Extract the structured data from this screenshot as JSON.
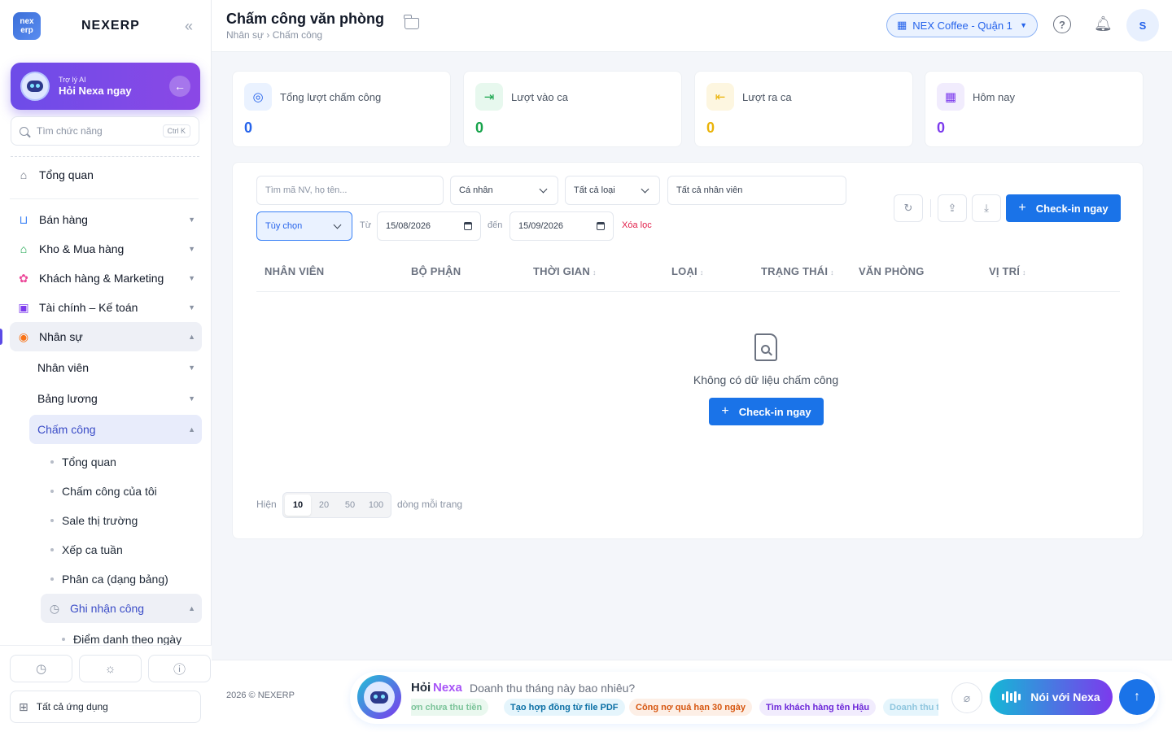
{
  "brand": {
    "logo_text": "nex erp",
    "name": "NEXERP"
  },
  "ai_card": {
    "small": "Trợ lý AI",
    "big": "Hỏi Nexa ngay"
  },
  "search": {
    "placeholder": "Tìm chức năng",
    "shortcut": "Ctrl K"
  },
  "sidebar": {
    "overview": "Tổng quan",
    "groups": [
      {
        "label": "Bán hàng",
        "icon": "cart-icon"
      },
      {
        "label": "Kho & Mua hàng",
        "icon": "bag-icon"
      },
      {
        "label": "Khách hàng & Marketing",
        "icon": "people-icon"
      },
      {
        "label": "Tài chính – Kế toán",
        "icon": "calculator-icon"
      },
      {
        "label": "Nhân sự",
        "icon": "user-circle-icon"
      }
    ],
    "hr_sub": [
      "Nhân viên",
      "Bảng lương",
      "Chấm công"
    ],
    "attendance_items": [
      "Tổng quan",
      "Chấm công của tôi",
      "Sale thị trường",
      "Xếp ca tuần",
      "Phân ca (dạng bảng)"
    ],
    "record_group": "Ghi nhận công",
    "record_items": [
      "Điểm danh theo ngày"
    ],
    "all_apps": "Tất cả ứng dụng"
  },
  "header": {
    "title": "Chấm công văn phòng",
    "breadcrumb": "Nhân sự › Chấm công",
    "branch": "NEX Coffee - Quận 1",
    "avatar": "S"
  },
  "stats": [
    {
      "label": "Tổng lượt chấm công",
      "value": "0",
      "color": "#2563eb",
      "bg": "#eaf2ff"
    },
    {
      "label": "Lượt vào ca",
      "value": "0",
      "color": "#16a34a",
      "bg": "#e7f8ee"
    },
    {
      "label": "Lượt ra ca",
      "value": "0",
      "color": "#eab308",
      "bg": "#fdf6e0"
    },
    {
      "label": "Hôm nay",
      "value": "0",
      "color": "#7c3aed",
      "bg": "#f1ecfd"
    }
  ],
  "filters": {
    "search_placeholder": "Tìm mã NV, họ tên...",
    "scope": "Cá nhân",
    "type": "Tất cả loại",
    "employee_placeholder": "Tất cả nhân viên",
    "range": "Tùy chọn",
    "from_label": "Từ",
    "from_date": "15/08/2026",
    "to_label": "đến",
    "to_date": "15/09/2026",
    "clear": "Xóa lọc",
    "checkin_button": "Check-in ngay"
  },
  "table": {
    "columns": [
      "NHÂN VIÊN",
      "BỘ PHẬN",
      "THỜI GIAN",
      "LOẠI",
      "TRẠNG THÁI",
      "VĂN PHÒNG",
      "VỊ TRÍ"
    ],
    "sort_glyph": "↕",
    "empty_text": "Không có dữ liệu chấm công",
    "empty_button": "Check-in ngay"
  },
  "pagination": {
    "show_label": "Hiện",
    "options": [
      "10",
      "20",
      "50",
      "100"
    ],
    "selected": "10",
    "suffix": "dòng mỗi trang"
  },
  "footer": {
    "copyright": "2026 © NEXERP",
    "nexa_hoi": "Hỏi",
    "nexa_name": "Nexa",
    "question": "Doanh thu tháng này bao nhiêu?",
    "chips": [
      "Đơn chưa thu tiền",
      "Tạo hợp đồng từ file PDF",
      "Công nợ quá hạn 30 ngày",
      "Tìm khách hàng tên Hậu",
      "Doanh thu tháng"
    ],
    "talk_button": "Nói với Nexa"
  }
}
